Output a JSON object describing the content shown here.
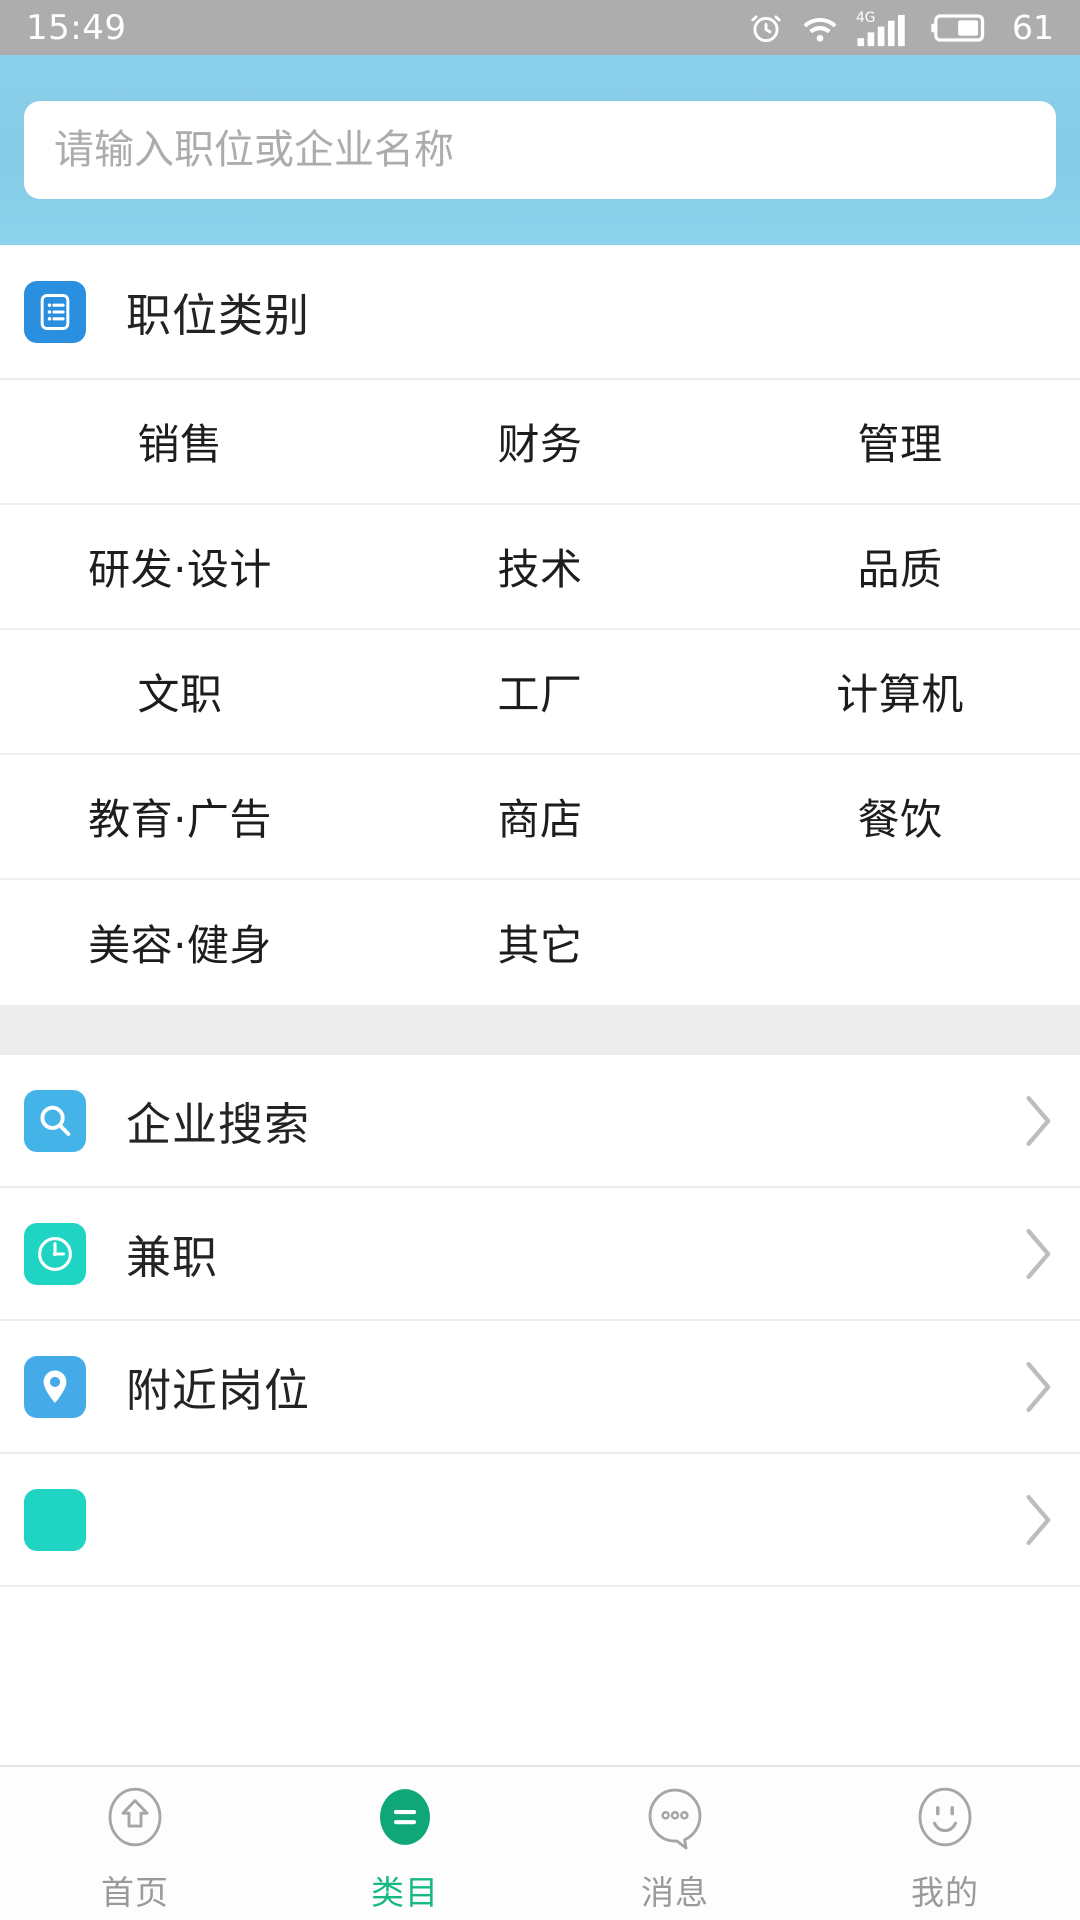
{
  "status_bar": {
    "time": "15:49",
    "battery_percent": "61",
    "network": "4G",
    "icons": [
      "alarm-icon",
      "wifi-icon",
      "signal-icon",
      "battery-icon"
    ]
  },
  "search": {
    "placeholder": "请输入职位或企业名称",
    "value": ""
  },
  "section": {
    "title": "职位类别",
    "icon": "list-document-icon",
    "icon_color": "#2B8FE0"
  },
  "categories": {
    "rows": [
      [
        "销售",
        "财务",
        "管理"
      ],
      [
        "研发·设计",
        "技术",
        "品质"
      ],
      [
        "文职",
        "工厂",
        "计算机"
      ],
      [
        "教育·广告",
        "商店",
        "餐饮"
      ],
      [
        "美容·健身",
        "其它",
        ""
      ]
    ]
  },
  "entries": [
    {
      "label": "企业搜索",
      "icon": "search-icon",
      "icon_color": "#44B4E8",
      "chevron": "chevron-right-icon"
    },
    {
      "label": "兼职",
      "icon": "clock-icon",
      "icon_color": "#1FD4C3",
      "chevron": "chevron-right-icon"
    },
    {
      "label": "附近岗位",
      "icon": "location-pin-icon",
      "icon_color": "#44ABE8",
      "chevron": "chevron-right-icon"
    },
    {
      "label": "",
      "icon": "partial-icon",
      "icon_color": "#1FD4C3",
      "chevron": "chevron-right-icon"
    }
  ],
  "tabbar": {
    "active_color": "#17B883",
    "inactive_color": "#9A9A9A",
    "items": [
      {
        "label": "首页",
        "icon": "home-icon",
        "active": false
      },
      {
        "label": "类目",
        "icon": "menu-icon",
        "active": true
      },
      {
        "label": "消息",
        "icon": "message-icon",
        "active": false
      },
      {
        "label": "我的",
        "icon": "smiley-icon",
        "active": false
      }
    ]
  }
}
